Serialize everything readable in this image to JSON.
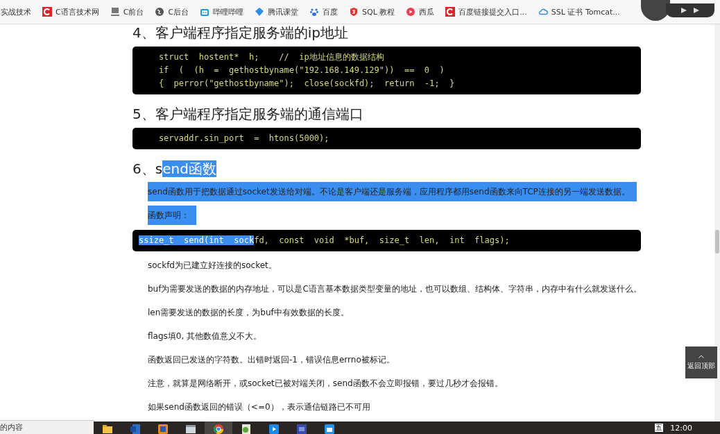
{
  "bookmarks": [
    {
      "label": "实战技术",
      "kind": "none"
    },
    {
      "label": "C语言技术网",
      "kind": "c-logo"
    },
    {
      "label": "C前台",
      "kind": "monitor"
    },
    {
      "label": "C后台",
      "kind": "globe"
    },
    {
      "label": "哔哩哔哩",
      "kind": "tv"
    },
    {
      "label": "腾讯课堂",
      "kind": "diamond"
    },
    {
      "label": "百度",
      "kind": "paw"
    },
    {
      "label": "SQL 教程",
      "kind": "shield"
    },
    {
      "label": "西瓜",
      "kind": "play"
    },
    {
      "label": "百度链接提交入口...",
      "kind": "c-logo"
    },
    {
      "label": "SSL 证书 Tomcat...",
      "kind": "cloud"
    }
  ],
  "article": [
    {
      "kind": "heading",
      "parts": [
        {
          "text": "4、客户端程序指定服务端的ip地址",
          "selected": false
        }
      ]
    },
    {
      "kind": "code",
      "lines": [
        {
          "parts": [
            {
              "text": "    struct  hostent*  h;    //  ip地址信息的数据结构",
              "selected": false
            }
          ]
        },
        {
          "parts": [
            {
              "text": "    if  (  (h  =  gethostbyname(\"192.168.149.129\"))  ==  0  )",
              "selected": false
            }
          ]
        },
        {
          "parts": [
            {
              "text": "    {  perror(\"gethostbyname\");  close(sockfd);  return  -1;  }",
              "selected": false
            }
          ]
        }
      ]
    },
    {
      "kind": "heading",
      "parts": [
        {
          "text": "5、客户端程序指定服务端的通信端口",
          "selected": false
        }
      ]
    },
    {
      "kind": "code",
      "lines": [
        {
          "parts": [
            {
              "text": "    servaddr.sin_port  =  htons(5000);",
              "selected": false
            }
          ]
        }
      ]
    },
    {
      "kind": "heading",
      "parts": [
        {
          "text": "6、s",
          "selected": false
        },
        {
          "text": "end函数",
          "selected": true
        }
      ]
    },
    {
      "kind": "para",
      "selected": true,
      "text": "send函数用于把数据通过socket发送给对端。不论是客户端还是服务端，应用程序都用send函数来向TCP连接的另一端发送数据。"
    },
    {
      "kind": "para",
      "selected": true,
      "text": "函数声明："
    },
    {
      "kind": "code",
      "lines": [
        {
          "parts": [
            {
              "text": "ssize_t  send(int  sock",
              "selected": true
            },
            {
              "text": "fd,  const  void  *buf,  size_t  len,  int  flags);",
              "selected": false
            }
          ]
        }
      ]
    },
    {
      "kind": "para",
      "selected": false,
      "text": "sockfd为已建立好连接的socket。"
    },
    {
      "kind": "para",
      "selected": false,
      "text": "buf为需要发送的数据的内存地址，可以是C语言基本数据类型变量的地址，也可以数组、结构体、字符串，内存中有什么就发送什么。"
    },
    {
      "kind": "para",
      "selected": false,
      "text": "len需要发送的数据的长度，为buf中有效数据的长度。"
    },
    {
      "kind": "para",
      "selected": false,
      "text": "flags填0, 其他数值意义不大。"
    },
    {
      "kind": "para",
      "selected": false,
      "text": "函数返回已发送的字符数。出错时返回-1，错误信息errno被标记。"
    },
    {
      "kind": "para",
      "selected": false,
      "text": "注意，就算是网络断开，或socket已被对端关闭，send函数不会立即报错，要过几秒才会报错。"
    },
    {
      "kind": "para",
      "selected": false,
      "text": "如果send函数返回的错误（<=0），表示通信链路已不可用"
    }
  ],
  "back_to_top": "返回顶部",
  "status_text": "的内容",
  "taskbar": {
    "apps": [
      {
        "kind": "folder",
        "selected": false
      },
      {
        "kind": "word",
        "selected": false
      },
      {
        "kind": "orange",
        "selected": false
      },
      {
        "kind": "window",
        "selected": false
      },
      {
        "kind": "chrome",
        "selected": true
      },
      {
        "kind": "green",
        "selected": false
      },
      {
        "kind": "video",
        "selected": false
      },
      {
        "kind": "vs",
        "selected": false
      },
      {
        "kind": "blue",
        "selected": false
      }
    ],
    "ime": "五",
    "time": "12:00"
  }
}
